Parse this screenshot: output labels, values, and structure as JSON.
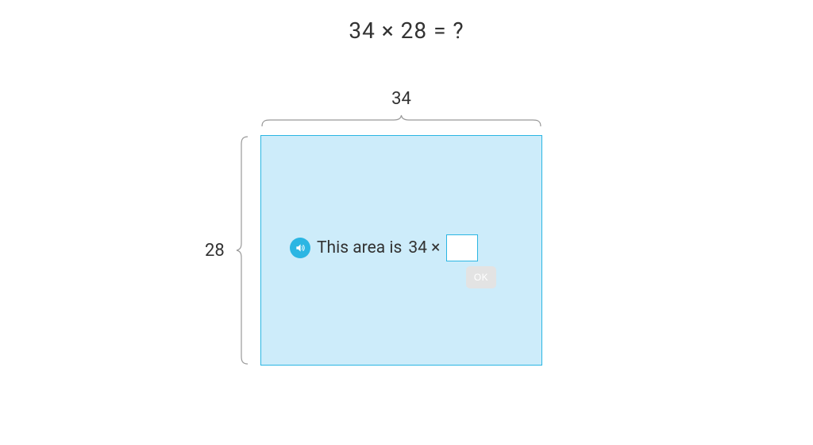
{
  "question": "34 × 28 = ?",
  "diagram": {
    "width_label": "34",
    "height_label": "28",
    "prompt_prefix": "This area is",
    "prompt_operand": "34 ×",
    "input_value": ""
  },
  "ok_label": "OK",
  "colors": {
    "accent": "#2bb6e3",
    "area_fill": "#cdecfa"
  }
}
